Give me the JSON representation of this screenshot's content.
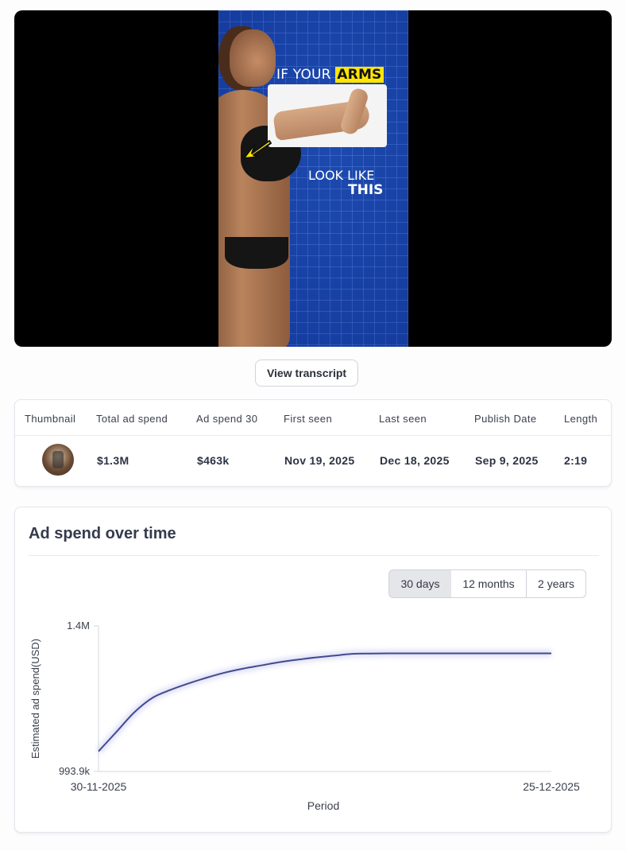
{
  "video": {
    "caption_line1": "IF YOUR",
    "caption_highlight": "ARMS",
    "caption_line2": "LOOK LIKE",
    "caption_line3": "THIS",
    "colors": {
      "background": "#000000",
      "frame": "#1b46a8",
      "highlight": "#ffe600"
    }
  },
  "transcript_button": {
    "label": "View transcript"
  },
  "ad_table": {
    "headers": [
      "Thumbnail",
      "Total ad spend",
      "Ad spend 30",
      "First seen",
      "Last seen",
      "Publish Date",
      "Length"
    ],
    "row": {
      "total_ad_spend": "$1.3M",
      "ad_spend_30": "$463k",
      "first_seen": "Nov 19, 2025",
      "last_seen": "Dec 18, 2025",
      "publish_date": "Sep 9, 2025",
      "length": "2:19"
    }
  },
  "chart_card": {
    "title": "Ad spend over time",
    "ranges": [
      "30 days",
      "12 months",
      "2 years"
    ],
    "active_range": "30 days"
  },
  "chart_data": {
    "type": "line",
    "xlabel": "Period",
    "ylabel": "Estimated ad spend(USD)",
    "x_tick_labels": [
      "30-11-2025",
      "25-12-2025"
    ],
    "y_tick_labels": [
      "1.4M",
      "993.9k"
    ],
    "ylim": [
      993900,
      1400000
    ],
    "grid": false,
    "series": [
      {
        "color": "#434a8f",
        "x": [
          "30-11-2025",
          "01-12-2025",
          "02-12-2025",
          "03-12-2025",
          "04-12-2025",
          "05-12-2025",
          "06-12-2025",
          "07-12-2025",
          "08-12-2025",
          "09-12-2025",
          "10-12-2025",
          "11-12-2025",
          "12-12-2025",
          "13-12-2025",
          "14-12-2025",
          "15-12-2025",
          "16-12-2025",
          "17-12-2025",
          "18-12-2025",
          "19-12-2025",
          "20-12-2025",
          "21-12-2025",
          "22-12-2025",
          "23-12-2025",
          "24-12-2025",
          "25-12-2025"
        ],
        "values": [
          1050000,
          1105000,
          1160000,
          1200000,
          1222000,
          1240000,
          1256000,
          1270000,
          1281000,
          1290000,
          1299000,
          1306000,
          1312000,
          1317000,
          1322000,
          1323000,
          1323500,
          1323500,
          1323500,
          1323500,
          1323500,
          1323500,
          1323500,
          1323500,
          1323500,
          1323500
        ]
      }
    ]
  }
}
